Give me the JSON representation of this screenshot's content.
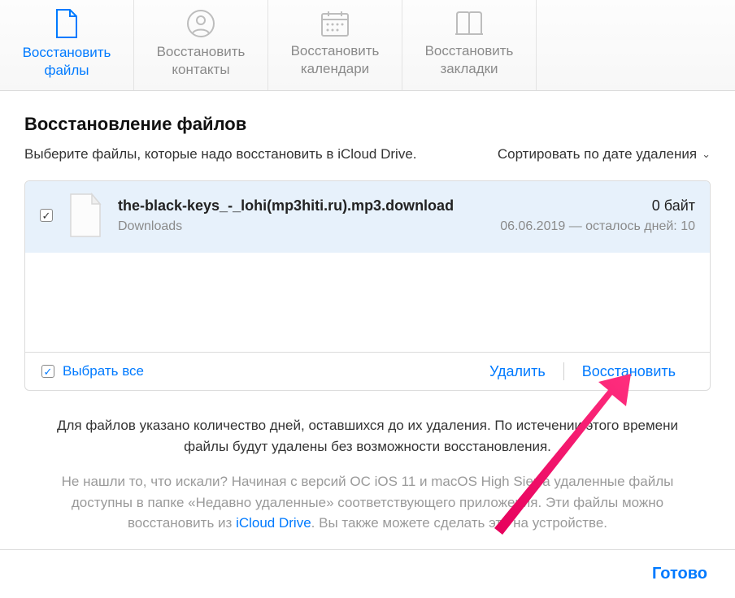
{
  "tabs": {
    "files": "Восстановить\nфайлы",
    "contacts": "Восстановить\nконтакты",
    "calendars": "Восстановить\nкалендари",
    "bookmarks": "Восстановить\nзакладки"
  },
  "main": {
    "title": "Восстановление файлов",
    "instruction": "Выберите файлы, которые надо восстановить в iCloud Drive.",
    "sortLabel": "Сортировать по дате удаления"
  },
  "file": {
    "name": "the-black-keys_-_lohi(mp3hiti.ru).mp3.download",
    "location": "Downloads",
    "size": "0 байт",
    "dateInfo": "06.06.2019 — осталось дней: 10"
  },
  "bar": {
    "selectAll": "Выбрать все",
    "delete": "Удалить",
    "restore": "Восстановить"
  },
  "footer": {
    "p1": "Для файлов указано количество дней, оставшихся до их удаления. По истечении этого времени файлы будут удалены без возможности восстановления.",
    "p2a": "Не нашли то, что искали? Начиная с версий ОС iOS 11 и macOS High Sierra удаленные файлы доступны в папке «Недавно удаленные» соответствующего приложения. Эти файлы можно восстановить из ",
    "p2link": "iCloud Drive",
    "p2b": ". Вы также можете сделать это на устройстве."
  },
  "doneLabel": "Готово"
}
